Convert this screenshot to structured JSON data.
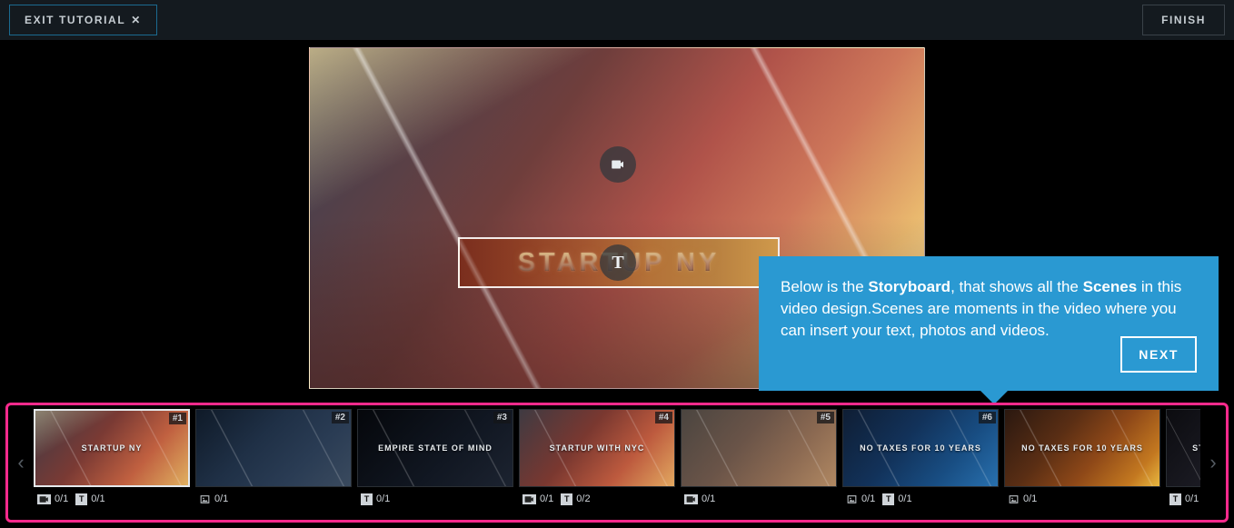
{
  "topbar": {
    "exit_label": "EXIT TUTORIAL",
    "finish_label": "FINISH"
  },
  "preview": {
    "title_text": "STARTUP NY"
  },
  "tooltip": {
    "t1": "Below is the ",
    "b1": "Storyboard",
    "t2": ", that shows all the ",
    "b2": "Scenes",
    "t3": " in this video design.Scenes are moments in the video where you can insert your text, photos and videos.",
    "next_label": "NEXT"
  },
  "storyboard": {
    "scenes": [
      {
        "num": "#1",
        "caption": "STARTUP NY",
        "meta": [
          {
            "icon": "video",
            "val": "0/1"
          },
          {
            "icon": "text",
            "val": "0/1"
          }
        ],
        "active": true
      },
      {
        "num": "#2",
        "caption": "",
        "meta": [
          {
            "icon": "image",
            "val": "0/1"
          }
        ]
      },
      {
        "num": "#3",
        "caption": "EMPIRE STATE OF MIND",
        "meta": [
          {
            "icon": "text",
            "val": "0/1"
          }
        ]
      },
      {
        "num": "#4",
        "caption": "STARTUP WITH NYC",
        "meta": [
          {
            "icon": "video",
            "val": "0/1"
          },
          {
            "icon": "text",
            "val": "0/2"
          }
        ]
      },
      {
        "num": "#5",
        "caption": "",
        "meta": [
          {
            "icon": "video",
            "val": "0/1"
          }
        ]
      },
      {
        "num": "#6",
        "caption": "NO TAXES FOR 10 YEARS",
        "meta": [
          {
            "icon": "image",
            "val": "0/1"
          },
          {
            "icon": "text",
            "val": "0/1"
          }
        ]
      },
      {
        "num": "",
        "caption": "NO TAXES FOR 10 YEARS",
        "meta": [
          {
            "icon": "image",
            "val": "0/1"
          }
        ]
      },
      {
        "num": "",
        "caption": "STARTU",
        "meta": [
          {
            "icon": "text",
            "val": "0/1"
          }
        ]
      }
    ]
  }
}
